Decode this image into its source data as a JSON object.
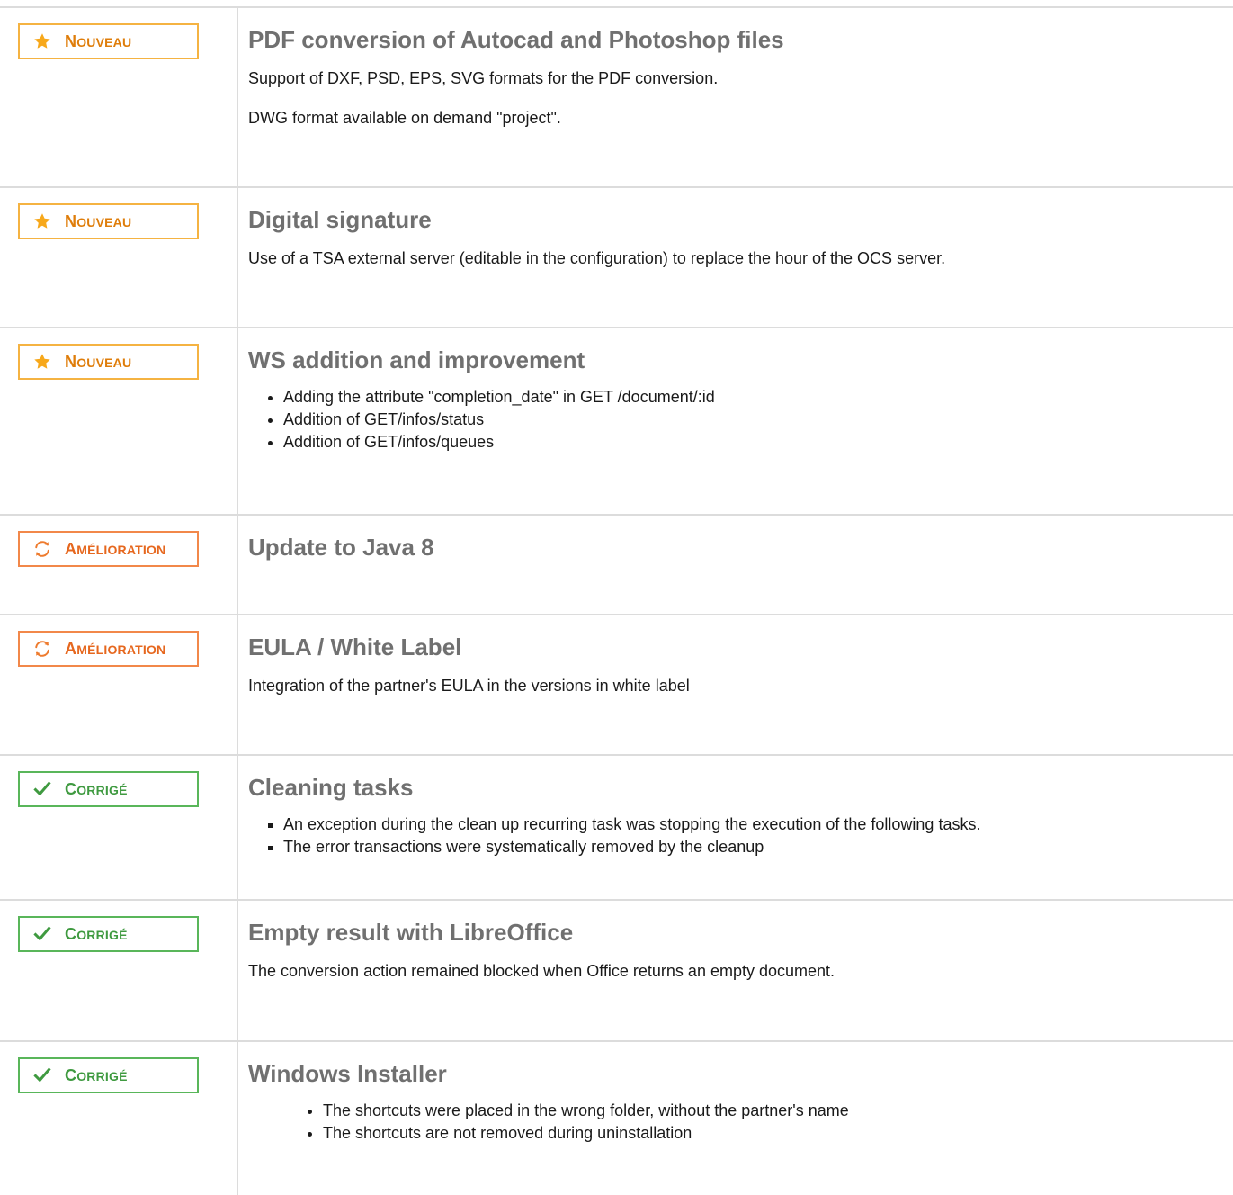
{
  "badges": {
    "new": {
      "cap": "N",
      "rest": "ouveau",
      "icon": "star-icon",
      "color": "#df7d0a"
    },
    "imp": {
      "cap": "A",
      "rest": "mélioration",
      "icon": "refresh-icon",
      "color": "#e6671e"
    },
    "fix": {
      "cap": "C",
      "rest": "orrigé",
      "icon": "check-icon",
      "color": "#3f9a40"
    }
  },
  "rows": [
    {
      "title": "PDF conversion of Autocad and Photoshop files",
      "paragraphs": [
        "Support of DXF, PSD, EPS, SVG formats for the PDF conversion.",
        "DWG format available on demand \"project\"."
      ]
    },
    {
      "title": "Digital signature",
      "paragraphs": [
        "Use of a TSA external server (editable in the configuration) to replace the hour of the OCS server."
      ]
    },
    {
      "title": "WS addition and improvement",
      "bullets": [
        "Adding the attribute \"completion_date\" in GET /document/:id",
        "Addition of GET/infos/status",
        "Addition of GET/infos/queues"
      ]
    },
    {
      "title": "Update to Java 8"
    },
    {
      "title": "EULA / White Label",
      "paragraphs": [
        "Integration of the partner's EULA in the versions in white label"
      ]
    },
    {
      "title": "Cleaning tasks",
      "bullets": [
        "An exception during the clean up recurring task was stopping the execution of the following tasks.",
        "The error transactions were systematically removed by the cleanup"
      ]
    },
    {
      "title": "Empty result with LibreOffice",
      "paragraphs": [
        "The conversion action remained blocked when Office returns an empty document."
      ]
    },
    {
      "title": "Windows Installer",
      "bullets": [
        "The shortcuts were placed in the wrong folder, without the partner's name",
        "The shortcuts are not removed during uninstallation"
      ]
    }
  ]
}
